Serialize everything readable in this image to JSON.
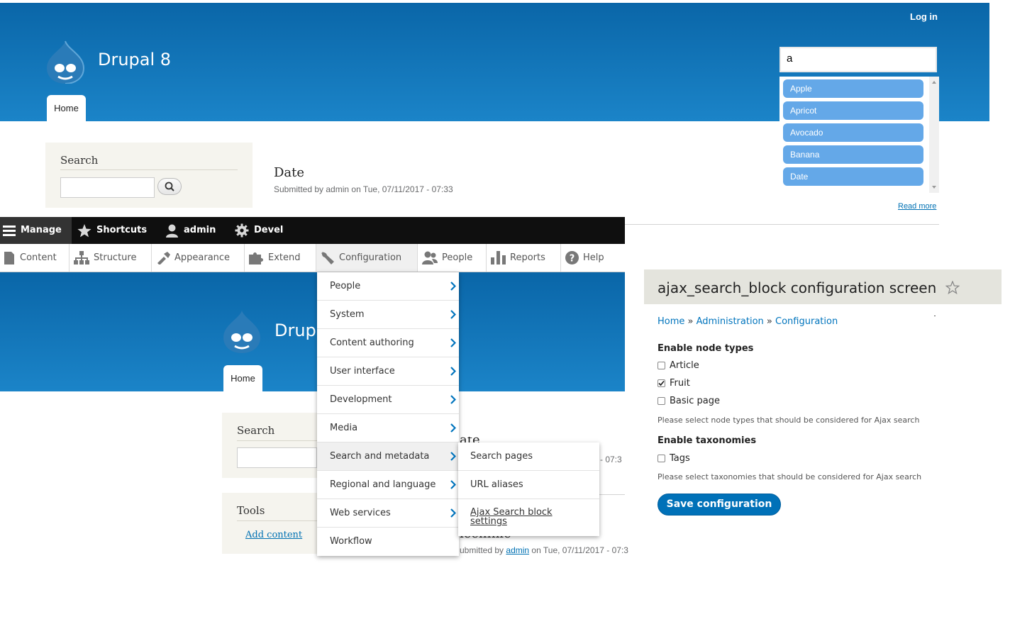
{
  "site": {
    "name": "Drupal 8",
    "home_tab": "Home",
    "login": "Log in"
  },
  "autocomplete": {
    "value": "a",
    "suggestions": [
      "Apple",
      "Apricot",
      "Avocado",
      "Banana",
      "Date"
    ]
  },
  "search_block": {
    "title": "Search"
  },
  "node": {
    "title": "Date",
    "meta": "Submitted by admin on Tue, 07/11/2017 - 07:33",
    "read_more": "Read more"
  },
  "site2": {
    "name_partial": "Drupa",
    "home_tab": "Home",
    "search_title": "Search",
    "tools_title": "Tools",
    "add_content": "Add content",
    "node_meta_prefix": "ubmitted by",
    "node_meta_author": "admin",
    "node_meta_suffix": "on Tue, 07/11/2017 - 07:3",
    "node_date_fragment": "- 07:3",
    "node_title_fragment_1": "ate",
    "node_title_fragment_2": "ieellflile"
  },
  "toolbar": {
    "manage": "Manage",
    "shortcuts": "Shortcuts",
    "user": "admin",
    "devel": "Devel",
    "tray": [
      "Content",
      "Structure",
      "Appearance",
      "Extend",
      "Configuration",
      "People",
      "Reports",
      "Help"
    ]
  },
  "config_menu": [
    "People",
    "System",
    "Content authoring",
    "User interface",
    "Development",
    "Media",
    "Search and metadata",
    "Regional and language",
    "Web services",
    "Workflow"
  ],
  "config_submenu": [
    "Search pages",
    "URL aliases",
    "Ajax Search block settings"
  ],
  "config_page": {
    "title": "ajax_search_block configuration screen",
    "breadcrumb": [
      "Home",
      "Administration",
      "Configuration"
    ],
    "breadcrumb_sep": "»",
    "node_types_label": "Enable node types",
    "node_types": [
      {
        "label": "Article",
        "checked": false
      },
      {
        "label": "Fruit",
        "checked": true
      },
      {
        "label": "Basic page",
        "checked": false
      }
    ],
    "node_types_desc": "Please select node types that should be considered for Ajax search",
    "taxonomies_label": "Enable taxonomies",
    "taxonomies": [
      {
        "label": "Tags",
        "checked": false
      }
    ],
    "taxonomies_desc": "Please select taxonomies that should be considered for Ajax search",
    "save": "Save configuration"
  },
  "colors": {
    "header_blue": "#1b84c8",
    "toolbar": "#0f0f0f",
    "link": "#0071b3",
    "suggestion": "#64a8e8",
    "button": "#0071b8"
  }
}
